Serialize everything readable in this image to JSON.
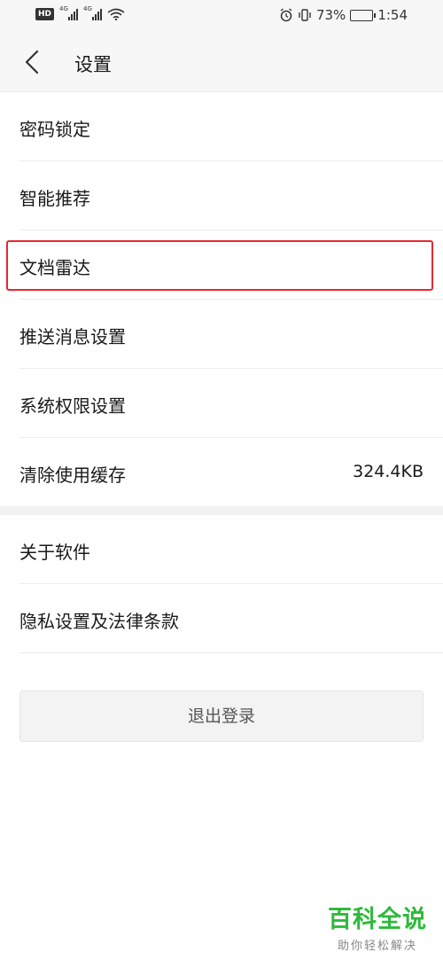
{
  "status_bar": {
    "hd_badge": "HD",
    "network_1": "4G",
    "network_2": "4G",
    "battery_percent": "73%",
    "battery_level": 0.73,
    "time": "1:54"
  },
  "header": {
    "title": "设置",
    "back_icon": "chevron-left-icon"
  },
  "settings": {
    "group_1": [
      {
        "label": "密码锁定"
      },
      {
        "label": "智能推荐"
      },
      {
        "label": "文档雷达",
        "highlighted": true
      },
      {
        "label": "推送消息设置"
      },
      {
        "label": "系统权限设置"
      },
      {
        "label": "清除使用缓存",
        "value": "324.4KB"
      }
    ],
    "group_2": [
      {
        "label": "关于软件"
      },
      {
        "label": "隐私设置及法律条款"
      }
    ]
  },
  "logout": {
    "label": "退出登录"
  },
  "watermark": {
    "title": "百科全说",
    "subtitle": "助你轻松解决"
  },
  "colors": {
    "highlight": "#e8282e",
    "watermark_green": "#2dba3a",
    "header_bg": "#f7f7f7",
    "divider": "#ececec"
  }
}
